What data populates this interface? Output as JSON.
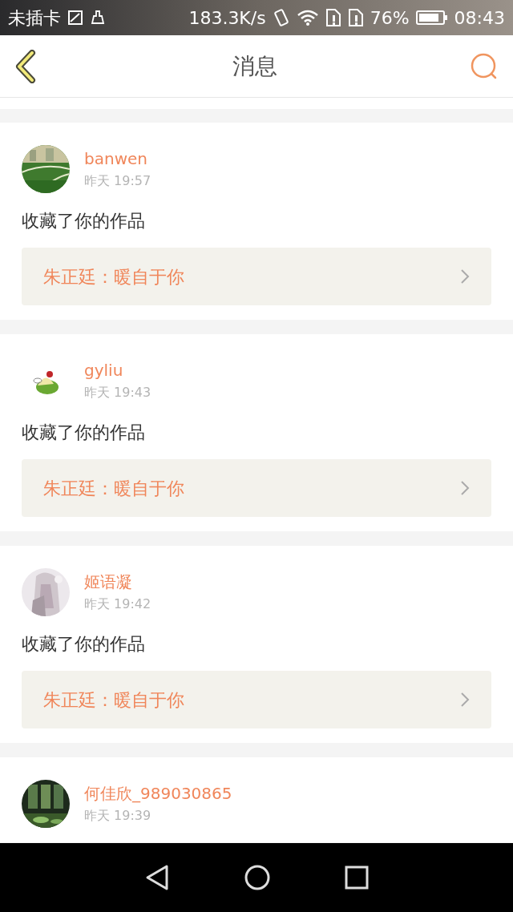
{
  "status_bar": {
    "carrier": "未插卡",
    "speed": "183.3K/s",
    "battery": "76%",
    "time": "08:43"
  },
  "header": {
    "title": "消息"
  },
  "messages": [
    {
      "user": "banwen",
      "time": "昨天 19:57",
      "action": "收藏了你的作品",
      "work": "朱正廷：暖自于你"
    },
    {
      "user": "gyliu",
      "time": "昨天 19:43",
      "action": "收藏了你的作品",
      "work": "朱正廷：暖自于你"
    },
    {
      "user": "姬语凝",
      "time": "昨天 19:42",
      "action": "收藏了你的作品",
      "work": "朱正廷：暖自于你"
    },
    {
      "user": "何佳欣_989030865",
      "time": "昨天 19:39"
    }
  ]
}
